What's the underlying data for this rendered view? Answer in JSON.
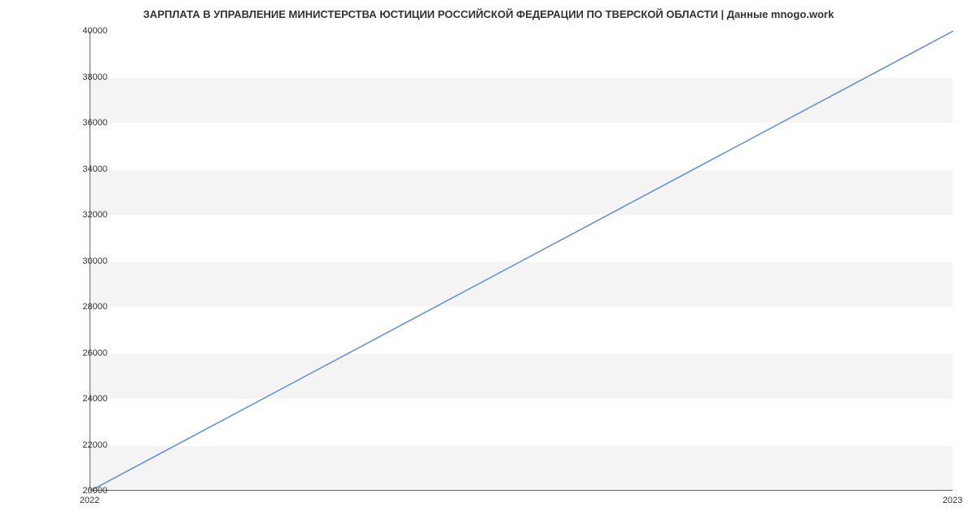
{
  "chart_data": {
    "type": "line",
    "title": "ЗАРПЛАТА В УПРАВЛЕНИЕ МИНИСТЕРСТВА ЮСТИЦИИ РОССИЙСКОЙ ФЕДЕРАЦИИ ПО ТВЕРСКОЙ ОБЛАСТИ | Данные mnogo.work",
    "x": [
      2022,
      2023
    ],
    "values": [
      20000,
      40000
    ],
    "xlabel": "",
    "ylabel": "",
    "ylim": [
      20000,
      40000
    ],
    "xlim": [
      2022,
      2023
    ],
    "y_ticks": [
      20000,
      22000,
      24000,
      26000,
      28000,
      30000,
      32000,
      34000,
      36000,
      38000,
      40000
    ],
    "x_ticks": [
      2022,
      2023
    ],
    "line_color": "#5b8fd6",
    "grid": true
  }
}
